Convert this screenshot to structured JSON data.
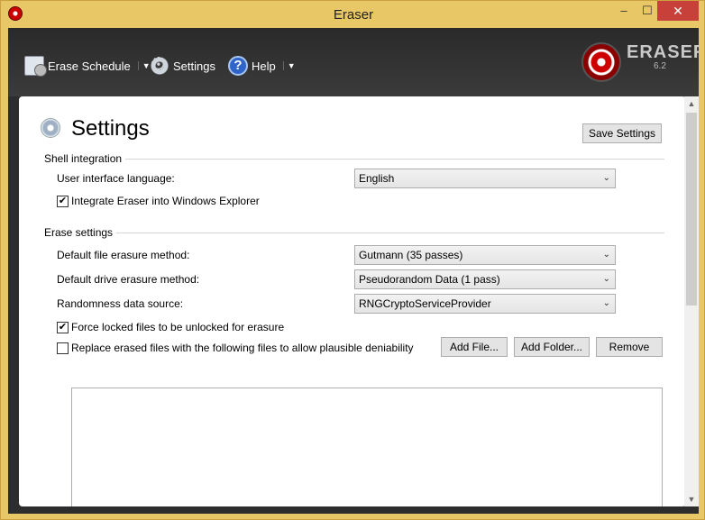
{
  "window": {
    "title": "Eraser",
    "minimize": "–",
    "maximize": "☐",
    "close": "✕"
  },
  "toolbar": {
    "erase_schedule": "Erase Schedule",
    "settings": "Settings",
    "help": "Help",
    "dropdown_arrow": "▼",
    "logo_text": "ERASER",
    "logo_version": "6.2"
  },
  "page": {
    "title": "Settings",
    "save_button": "Save Settings"
  },
  "shell": {
    "group": "Shell integration",
    "language_label": "User interface language:",
    "language_value": "English",
    "integrate_label": "Integrate Eraser into Windows Explorer",
    "integrate_checked": "✔"
  },
  "erase": {
    "group": "Erase settings",
    "file_method_label": "Default file erasure method:",
    "file_method_value": "Gutmann (35 passes)",
    "drive_method_label": "Default drive erasure method:",
    "drive_method_value": "Pseudorandom Data (1 pass)",
    "random_label": "Randomness data source:",
    "random_value": "RNGCryptoServiceProvider",
    "force_unlock_label": "Force locked files to be unlocked for erasure",
    "force_unlock_checked": "✔",
    "replace_label": "Replace erased files with the following files to allow plausible deniability",
    "add_file": "Add File...",
    "add_folder": "Add Folder...",
    "remove": "Remove"
  },
  "scrollbar": {
    "up": "▲",
    "down": "▼"
  },
  "select_chevron": "⌄"
}
